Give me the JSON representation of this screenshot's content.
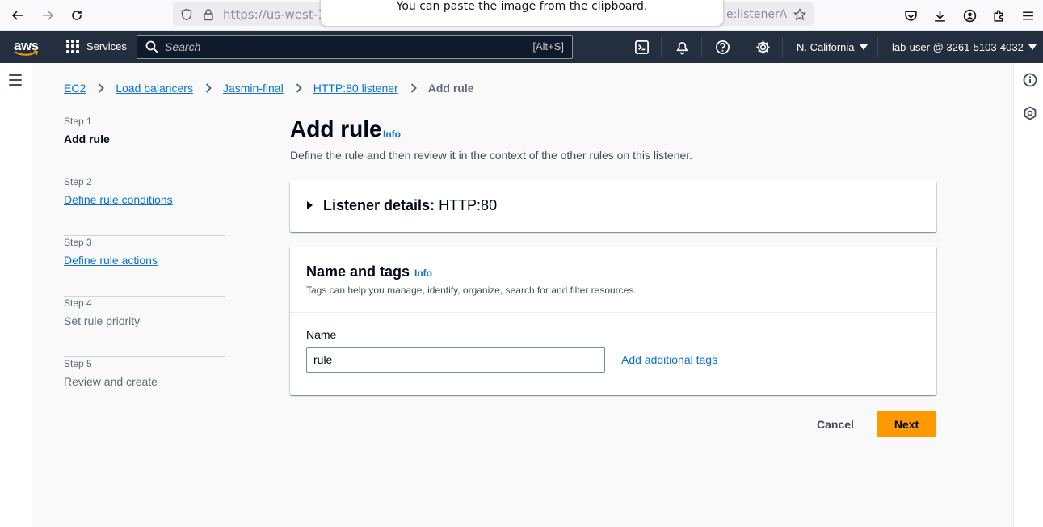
{
  "browser": {
    "url": "https://us-west-1",
    "url_tail": "e:listenerA",
    "toast": "You can paste the image from the clipboard."
  },
  "aws_nav": {
    "logo": "aws",
    "services_label": "Services",
    "search_placeholder": "Search",
    "search_shortcut": "[Alt+S]",
    "region": "N. California",
    "account": "lab-user @ 3261-5103-4032"
  },
  "breadcrumbs": [
    {
      "label": "EC2"
    },
    {
      "label": "Load balancers"
    },
    {
      "label": "Jasmin-final"
    },
    {
      "label": "HTTP:80 listener"
    },
    {
      "label": "Add rule"
    }
  ],
  "steps": [
    {
      "number": "Step 1",
      "title": "Add rule"
    },
    {
      "number": "Step 2",
      "title": "Define rule conditions"
    },
    {
      "number": "Step 3",
      "title": "Define rule actions"
    },
    {
      "number": "Step 4",
      "title": "Set rule priority"
    },
    {
      "number": "Step 5",
      "title": "Review and create"
    }
  ],
  "page": {
    "title": "Add rule",
    "info": "Info",
    "description": "Define the rule and then review it in the context of the other rules on this listener."
  },
  "listener_details": {
    "label": "Listener details:",
    "value": "HTTP:80"
  },
  "name_tags": {
    "title": "Name and tags",
    "info": "Info",
    "description": "Tags can help you manage, identify, organize, search for and filter resources.",
    "name_label": "Name",
    "name_value": "rule",
    "add_tags": "Add additional tags"
  },
  "actions": {
    "cancel": "Cancel",
    "next": "Next"
  },
  "colors": {
    "nav_bg": "#232f3e",
    "link": "#0972d3",
    "primary_button": "#ff9900"
  }
}
